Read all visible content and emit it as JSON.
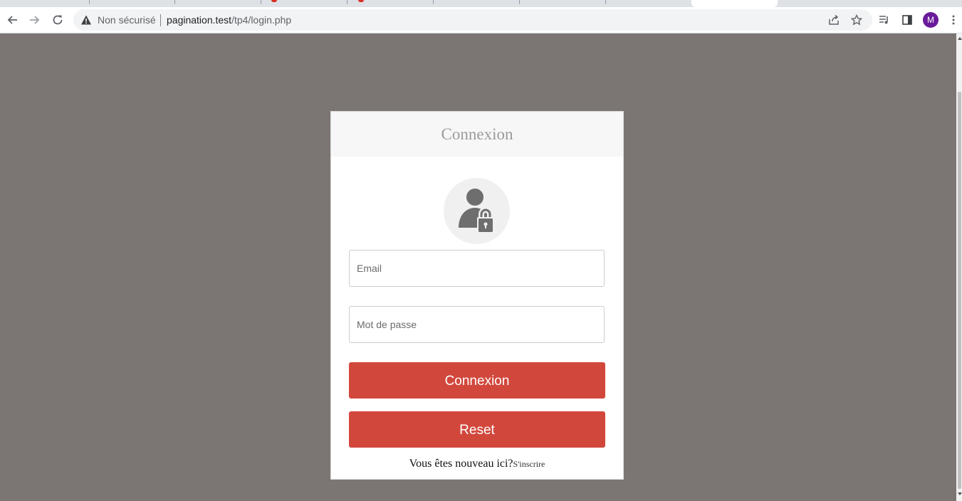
{
  "browser": {
    "security_label": "Non sécurisé",
    "url_host": "pagination.test",
    "url_path": "/tp4/login.php",
    "profile_initial": "M"
  },
  "login": {
    "title": "Connexion",
    "email_placeholder": "Email",
    "password_placeholder": "Mot de passe",
    "submit_label": "Connexion",
    "reset_label": "Reset",
    "new_user_text": "Vous êtes nouveau ici?",
    "signup_link": "S'inscrire"
  },
  "colors": {
    "page_background": "#7b7574",
    "button": "#d2473c",
    "avatar": "#6a1b9a"
  }
}
